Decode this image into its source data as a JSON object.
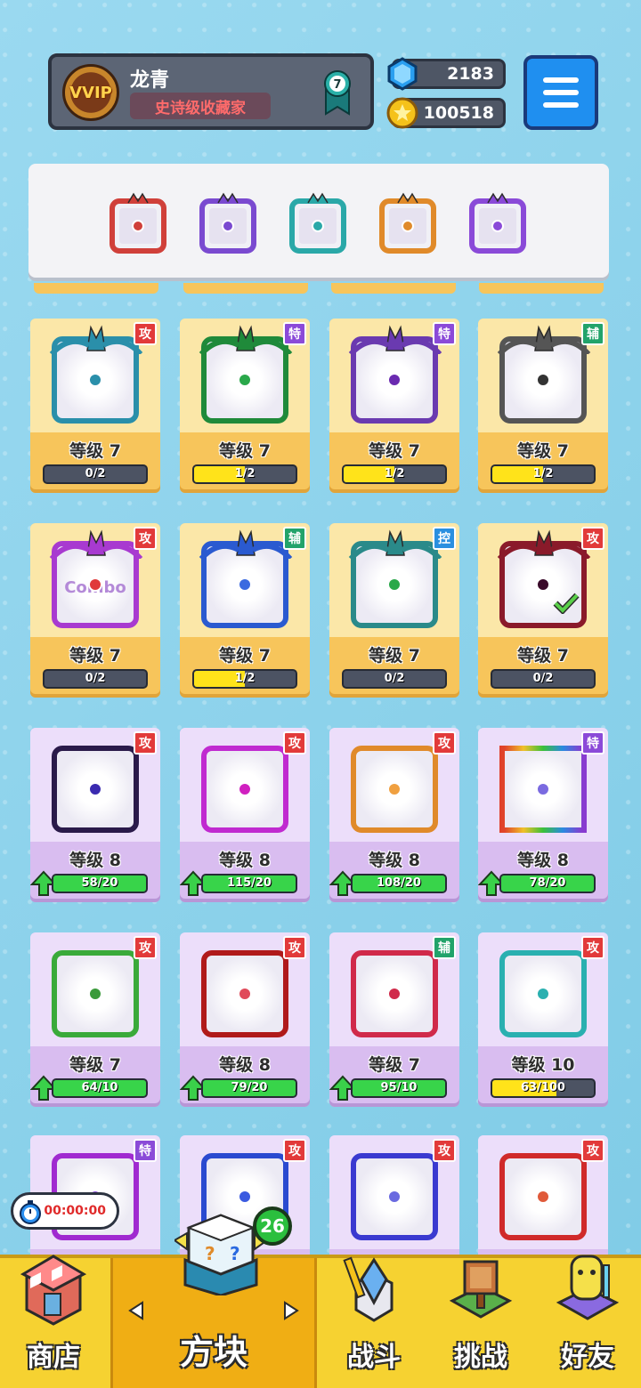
{
  "header": {
    "vip_label": "VVIP",
    "player_name": "龙青",
    "player_title": "史诗级收藏家",
    "rank": "7",
    "gems": "2183",
    "coins": "100518"
  },
  "equipped": [
    {
      "name": "vortex-dragon-die",
      "color": "#d0403a"
    },
    {
      "name": "purple-shard-die",
      "color": "#7a4ad0"
    },
    {
      "name": "teal-hands-die",
      "color": "#2aa8a8"
    },
    {
      "name": "infinity-dragon-die",
      "color": "#e08a2a"
    },
    {
      "name": "purple-dragon-die",
      "color": "#8a4ad8"
    }
  ],
  "cards": [
    {
      "tag": "攻",
      "tag_type": "atk",
      "level": "等级 7",
      "progress": "0/2",
      "fill_fraction": 0,
      "frame": "#2a8faa",
      "dot": "#2a8faa",
      "style": "gold",
      "bar": "yellow"
    },
    {
      "tag": "特",
      "tag_type": "spc",
      "level": "等级 7",
      "progress": "1/2",
      "fill_fraction": 0.5,
      "frame": "#1f8a3a",
      "dot": "#2aa84a",
      "style": "gold",
      "bar": "yellow"
    },
    {
      "tag": "特",
      "tag_type": "spc",
      "level": "等级 7",
      "progress": "1/2",
      "fill_fraction": 0.5,
      "frame": "#6a3ab0",
      "dot": "#6a2ab0",
      "style": "gold",
      "bar": "yellow"
    },
    {
      "tag": "辅",
      "tag_type": "sup",
      "level": "等级 7",
      "progress": "1/2",
      "fill_fraction": 0.5,
      "frame": "#555555",
      "dot": "#333333",
      "style": "gold",
      "bar": "yellow"
    },
    {
      "tag": "攻",
      "tag_type": "atk",
      "level": "等级 7",
      "progress": "0/2",
      "fill_fraction": 0,
      "frame": "#a83ad0",
      "dot": "#e03a3a",
      "style": "gold",
      "bar": "yellow",
      "art_text": "Combo"
    },
    {
      "tag": "辅",
      "tag_type": "sup",
      "level": "等级 7",
      "progress": "1/2",
      "fill_fraction": 0.5,
      "frame": "#2a5ad0",
      "dot": "#3a6ae0",
      "style": "gold",
      "bar": "yellow"
    },
    {
      "tag": "控",
      "tag_type": "ctl",
      "level": "等级 7",
      "progress": "0/2",
      "fill_fraction": 0,
      "frame": "#2a8a8a",
      "dot": "#2aa84a",
      "style": "gold",
      "bar": "yellow"
    },
    {
      "tag": "攻",
      "tag_type": "atk",
      "level": "等级 7",
      "progress": "0/2",
      "fill_fraction": 0,
      "frame": "#8a1a2a",
      "dot": "#3a0a2a",
      "style": "gold",
      "bar": "yellow",
      "equipped": true
    },
    {
      "tag": "攻",
      "tag_type": "atk",
      "level": "等级 8",
      "progress": "58/20",
      "fill_fraction": 1,
      "frame": "#2a1a4a",
      "dot": "#3a2ab0",
      "style": "purple",
      "bar": "green"
    },
    {
      "tag": "攻",
      "tag_type": "atk",
      "level": "等级 8",
      "progress": "115/20",
      "fill_fraction": 1,
      "frame": "#c02ad0",
      "dot": "#d020c0",
      "style": "purple",
      "bar": "green"
    },
    {
      "tag": "攻",
      "tag_type": "atk",
      "level": "等级 8",
      "progress": "108/20",
      "fill_fraction": 1,
      "frame": "#e08a2a",
      "dot": "#f0a040",
      "style": "purple",
      "bar": "green"
    },
    {
      "tag": "特",
      "tag_type": "spc",
      "level": "等级 8",
      "progress": "78/20",
      "fill_fraction": 1,
      "frame": "#e0402a",
      "dot": "#7a6ae0",
      "style": "purple",
      "bar": "green",
      "rainbow": true
    },
    {
      "tag": "攻",
      "tag_type": "atk",
      "level": "等级 7",
      "progress": "64/10",
      "fill_fraction": 1,
      "frame": "#3aaa3a",
      "dot": "#3a9a3a",
      "style": "purple",
      "bar": "green"
    },
    {
      "tag": "攻",
      "tag_type": "atk",
      "level": "等级 8",
      "progress": "79/20",
      "fill_fraction": 1,
      "frame": "#b01a1a",
      "dot": "#e04a5a",
      "style": "purple",
      "bar": "green"
    },
    {
      "tag": "辅",
      "tag_type": "sup",
      "level": "等级 7",
      "progress": "95/10",
      "fill_fraction": 1,
      "frame": "#d02a4a",
      "dot": "#d02a4a",
      "style": "purple",
      "bar": "green"
    },
    {
      "tag": "攻",
      "tag_type": "atk",
      "level": "等级 10",
      "progress": "63/100",
      "fill_fraction": 0.63,
      "frame": "#2ab0b0",
      "dot": "#2ab0b0",
      "style": "purple",
      "bar": "yellow"
    },
    {
      "tag": "特",
      "tag_type": "spc",
      "level": "",
      "progress": "",
      "fill_fraction": 0,
      "frame": "#a02ad0",
      "dot": "#8a4ad8",
      "style": "purple",
      "bar": "none"
    },
    {
      "tag": "攻",
      "tag_type": "atk",
      "level": "",
      "progress": "",
      "fill_fraction": 0,
      "frame": "#2a4ad0",
      "dot": "#3a5ae0",
      "style": "purple",
      "bar": "none"
    },
    {
      "tag": "攻",
      "tag_type": "atk",
      "level": "",
      "progress": "",
      "fill_fraction": 0,
      "frame": "#3a3ad0",
      "dot": "#6a6ae0",
      "style": "purple",
      "bar": "none"
    },
    {
      "tag": "攻",
      "tag_type": "atk",
      "level": "",
      "progress": "",
      "fill_fraction": 0,
      "frame": "#d02a2a",
      "dot": "#e05a3a",
      "style": "purple",
      "bar": "none"
    }
  ],
  "timer": "00:00:00",
  "dice_count": "26",
  "nav": [
    {
      "label": "商店",
      "icon": "shop-icon"
    },
    {
      "label": "方块",
      "icon": "dice-box-icon",
      "active": true
    },
    {
      "label": "战斗",
      "icon": "battle-icon"
    },
    {
      "label": "挑战",
      "icon": "challenge-icon"
    },
    {
      "label": "好友",
      "icon": "friends-icon"
    }
  ]
}
